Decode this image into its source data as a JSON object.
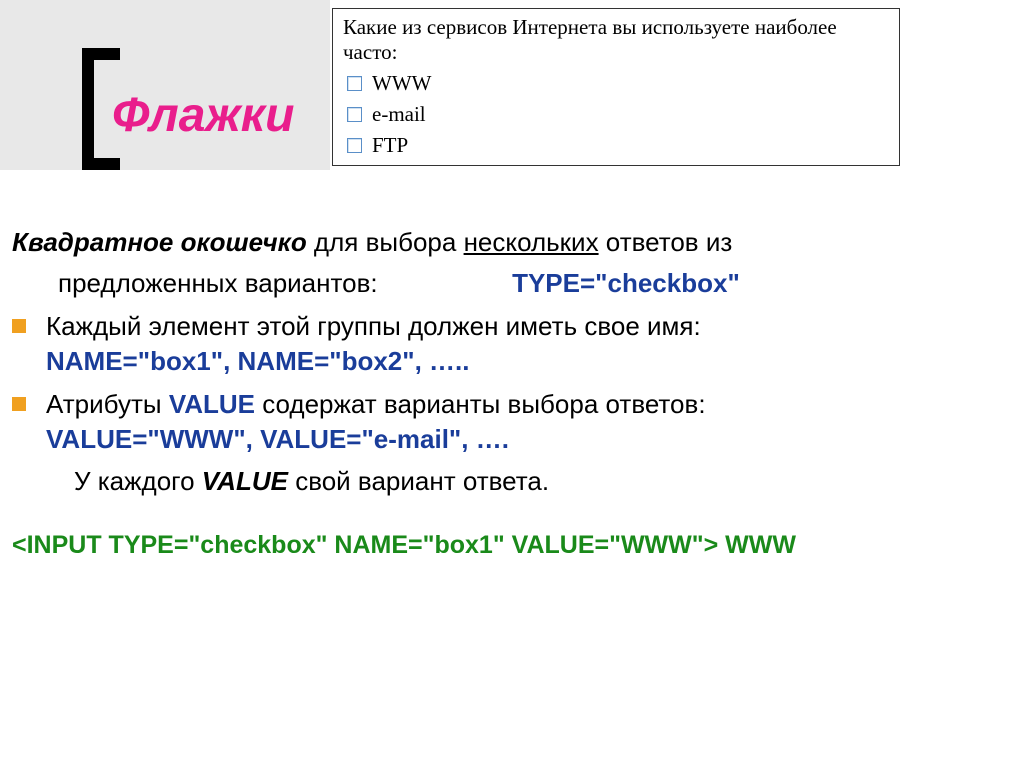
{
  "title": "Флажки",
  "example": {
    "question": "Какие из сервисов Интернета вы используете наиболее часто:",
    "options": [
      "WWW",
      "e-mail",
      "FTP"
    ]
  },
  "intro": {
    "lead": "Квадратное окошечко",
    "rest1": " для выбора ",
    "underlined": "нескольких",
    "rest2": " ответов из",
    "line2_pre": "предложенных вариантов:",
    "type_attr": "TYPE=\"checkbox\""
  },
  "bullets": [
    {
      "text": "Каждый элемент этой группы должен иметь свое имя:",
      "code": "NAME=\"box1\",  NAME=\"box2\",    ….."
    },
    {
      "text_pre": "Атрибуты ",
      "text_kw": "VALUE",
      "text_post": " содержат варианты выбора ответов:",
      "code": "VALUE=\"WWW\", VALUE=\"e-mail\", …."
    }
  ],
  "note": {
    "pre": "У каждого ",
    "kw": "VALUE",
    "post": " свой вариант ответа."
  },
  "code_example": "<INPUT   TYPE=\"checkbox\"  NAME=\"box1\"  VALUE=\"WWW\"> WWW"
}
